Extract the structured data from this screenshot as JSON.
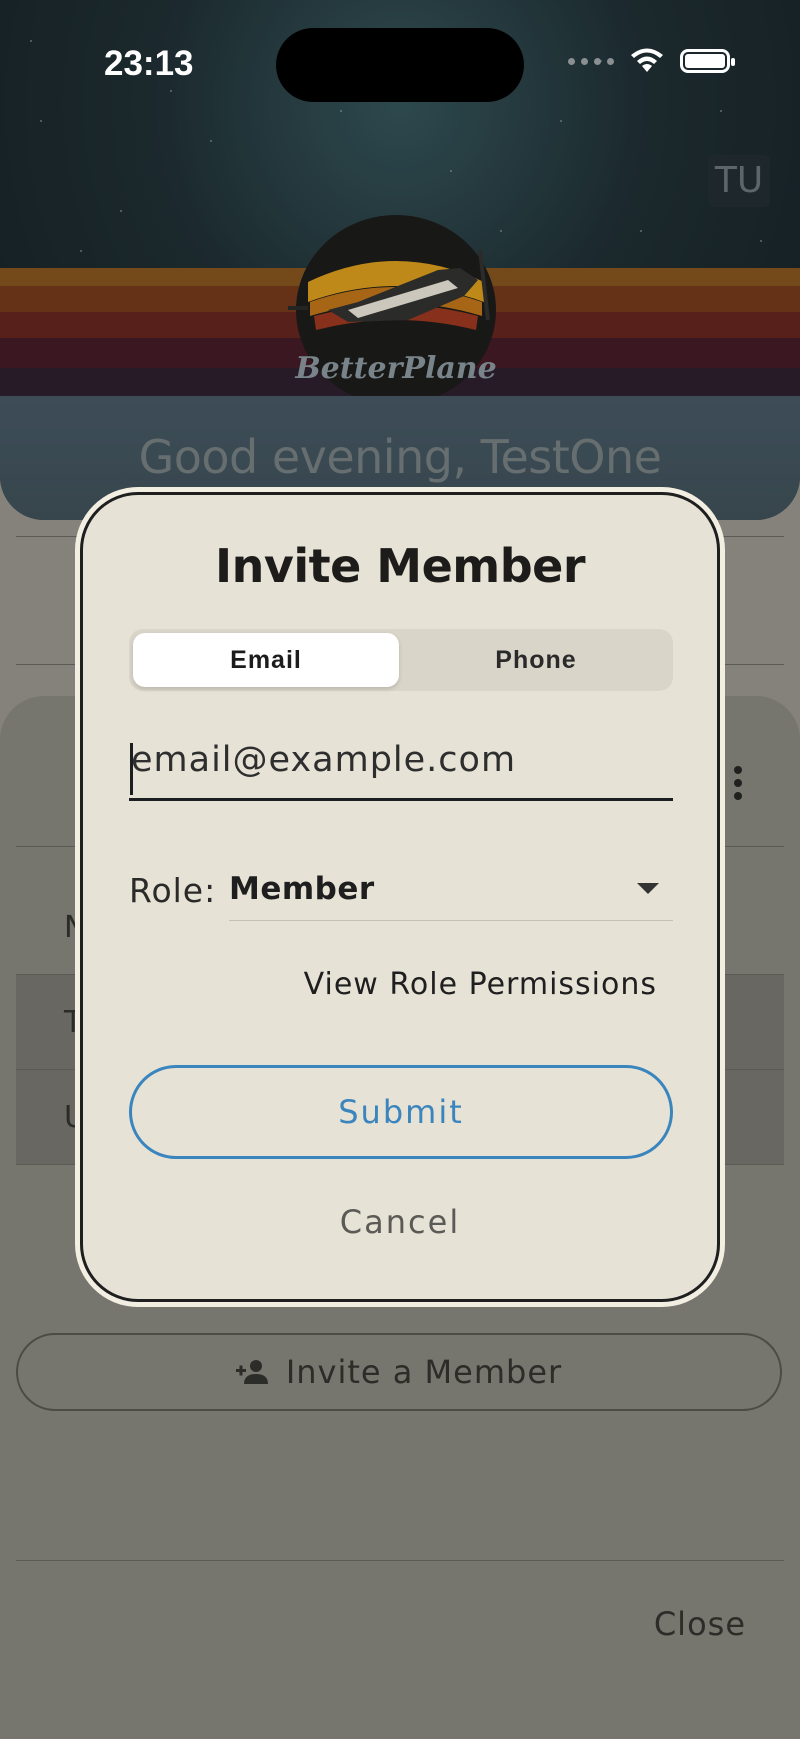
{
  "status_bar": {
    "time": "23:13"
  },
  "background": {
    "avatar_initials": "TU",
    "logo_text": "BetterPlane",
    "greeting": "Good evening, TestOne",
    "rows": [
      "N",
      "T",
      "U"
    ],
    "invite_button_label": "Invite a Member",
    "close_label": "Close"
  },
  "dialog": {
    "title": "Invite Member",
    "tabs": [
      {
        "label": "Email",
        "selected": true
      },
      {
        "label": "Phone",
        "selected": false
      }
    ],
    "email_placeholder": "email@example.com",
    "email_value": "",
    "role_label": "Role:",
    "role_value": "Member",
    "view_permissions_label": "View Role Permissions",
    "submit_label": "Submit",
    "cancel_label": "Cancel"
  },
  "colors": {
    "dialog_background": "#e6e2d6",
    "accent_blue": "#3a85bd",
    "scrim": "#7b7a73"
  }
}
